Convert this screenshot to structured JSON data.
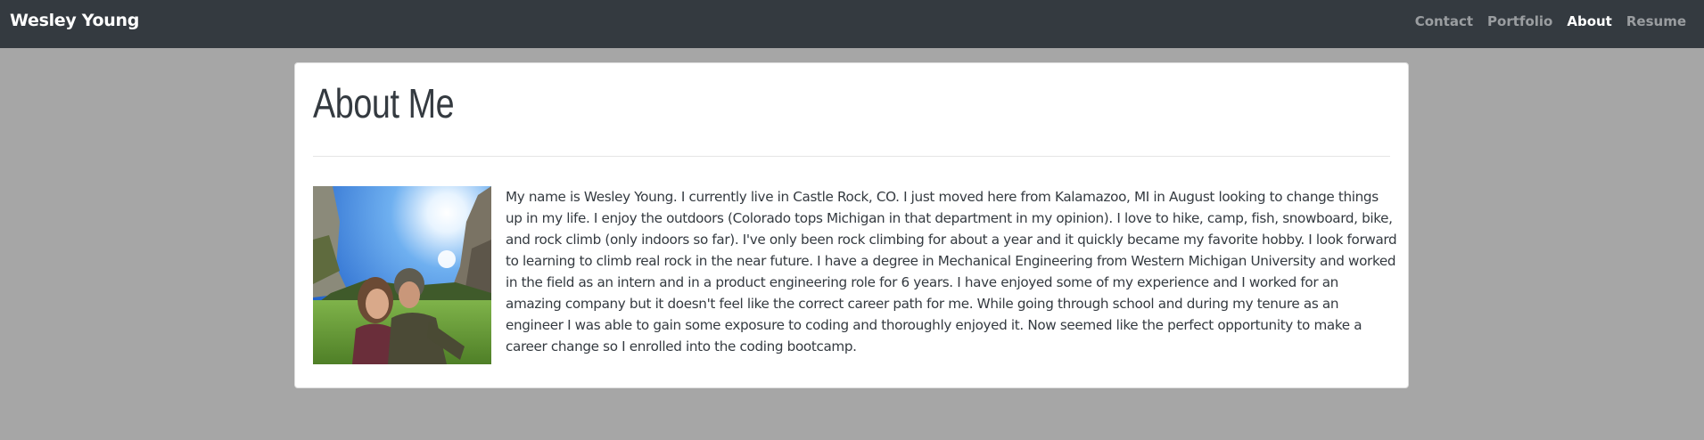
{
  "navbar": {
    "brand": "Wesley Young",
    "links": [
      {
        "label": "Contact",
        "active": false
      },
      {
        "label": "Portfolio",
        "active": false
      },
      {
        "label": "About",
        "active": true
      },
      {
        "label": "Resume",
        "active": false
      }
    ]
  },
  "main": {
    "title": "About Me",
    "bio": "My name is Wesley Young. I currently live in Castle Rock, CO. I just moved here from Kalamazoo, MI in August looking to change things up in my life. I enjoy the outdoors (Colorado tops Michigan in that department in my opinion). I love to hike, camp, fish, snowboard, bike, and rock climb (only indoors so far). I've only been rock climbing for about a year and it quickly became my favorite hobby. I look forward to learning to climb real rock in the near future. I have a degree in Mechanical Engineering from Western Michigan University and worked in the field as an intern and in a product engineering role for 6 years. I have enjoyed some of my experience and I worked for an amazing company but it doesn't feel like the correct career path for me. While going through school and during my tenure as an engineer I was able to gain some exposure to coding and thoroughly enjoyed it. Now seemed like the perfect opportunity to make a career change so I enrolled into the coding bootcamp."
  },
  "colors": {
    "navbar_bg": "#343a40",
    "page_bg": "#a6a6a6",
    "card_bg": "#ffffff",
    "text": "#343a40"
  }
}
